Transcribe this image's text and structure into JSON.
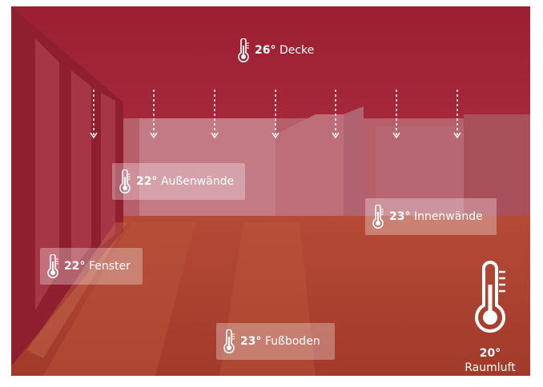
{
  "ceiling": {
    "temp": "26°",
    "name": "Decke",
    "icon": "thermometer-icon"
  },
  "walls_outer": {
    "temp": "22°",
    "name": "Außenwände",
    "icon": "thermometer-icon"
  },
  "walls_inner": {
    "temp": "23°",
    "name": "Innenwände",
    "icon": "thermometer-icon"
  },
  "window": {
    "temp": "22°",
    "name": "Fenster",
    "icon": "thermometer-icon"
  },
  "floor": {
    "temp": "23°",
    "name": "Fußboden",
    "icon": "thermometer-icon"
  },
  "room_air": {
    "temp": "20°",
    "name": "Raumluft",
    "icon": "thermometer-large-icon"
  },
  "colors": {
    "overlay": "#a32a39",
    "label_bg": "rgba(255,255,255,0.30)",
    "text": "#ffffff"
  }
}
